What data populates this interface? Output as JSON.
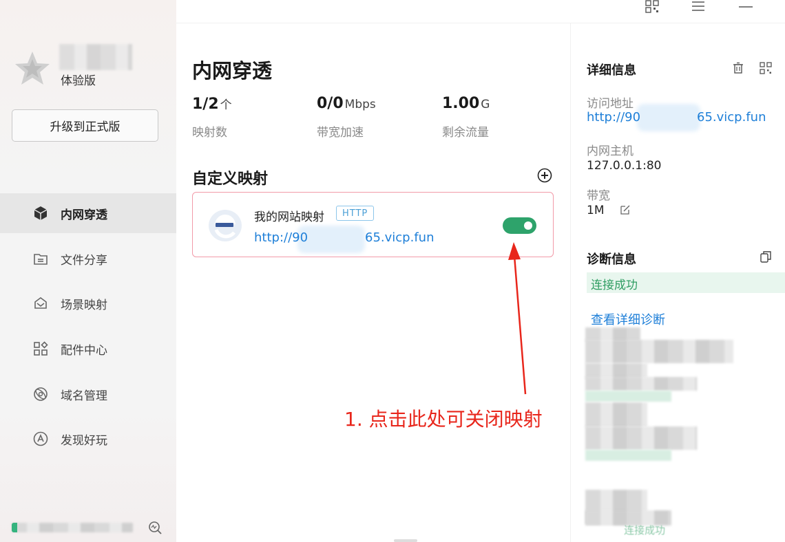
{
  "window": {
    "controls": [
      "qrcode-icon",
      "menu-icon",
      "minimize-icon"
    ]
  },
  "sidebar": {
    "edition": "体验版",
    "upgrade_label": "升级到正式版",
    "items": [
      {
        "label": "内网穿透",
        "icon": "cube-icon",
        "active": true
      },
      {
        "label": "文件分享",
        "icon": "folder-icon",
        "active": false
      },
      {
        "label": "场景映射",
        "icon": "layers-icon",
        "active": false
      },
      {
        "label": "配件中心",
        "icon": "grid-icon",
        "active": false
      },
      {
        "label": "域名管理",
        "icon": "globe-icon",
        "active": false
      },
      {
        "label": "发现好玩",
        "icon": "compass-icon",
        "active": false
      }
    ]
  },
  "main": {
    "title": "内网穿透",
    "stats": [
      {
        "value": "1/2",
        "unit": "个",
        "label": "映射数"
      },
      {
        "value": "0/0",
        "unit": "Mbps",
        "label": "带宽加速"
      },
      {
        "value": "1.00",
        "unit": "G",
        "label": "剩余流量"
      }
    ],
    "section_title": "自定义映射",
    "mapping": {
      "name": "我的网站映射",
      "protocol": "HTTP",
      "url_prefix": "http://90",
      "url_suffix": "65.vicp.fun",
      "enabled": true
    },
    "annotation": "1. 点击此处可关闭映射"
  },
  "detail": {
    "title": "详细信息",
    "access_label": "访问地址",
    "access_prefix": "http://90",
    "access_suffix": "65.vicp.fun",
    "host_label": "内网主机",
    "host_value": "127.0.0.1:80",
    "bandwidth_label": "带宽",
    "bandwidth_value": "1M",
    "diag_title": "诊断信息",
    "diag_status": "连接成功",
    "diag_link": "查看详细诊断",
    "footer_partial": "        连接成功"
  },
  "colors": {
    "accent": "#1e7fd8",
    "success": "#2ea36b",
    "card_border": "#f29aa8",
    "annotation": "#e8261b"
  }
}
